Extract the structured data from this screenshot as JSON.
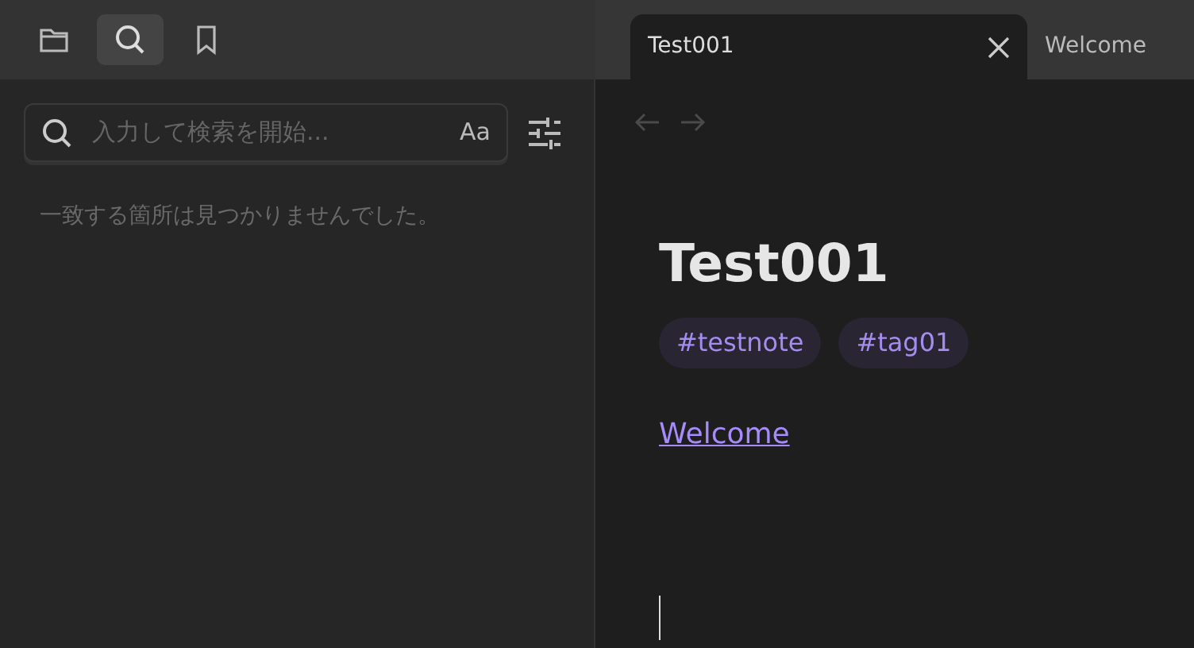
{
  "sidebar": {
    "tabs": [
      {
        "kind": "files",
        "selected": false
      },
      {
        "kind": "search",
        "selected": true
      },
      {
        "kind": "bookmarks",
        "selected": false
      }
    ],
    "search": {
      "placeholder": "入力して検索を開始...",
      "case_toggle": "Aa"
    },
    "empty_message": "一致する箇所は見つかりませんでした。"
  },
  "tabs": [
    {
      "label": "Test001",
      "selected": true
    },
    {
      "label": "Welcome",
      "selected": false
    }
  ],
  "nav": {
    "back_disabled": true,
    "forward_disabled": true
  },
  "note": {
    "title": "Test001",
    "tags": [
      "#testnote",
      "#tag01"
    ],
    "link": "Welcome"
  }
}
